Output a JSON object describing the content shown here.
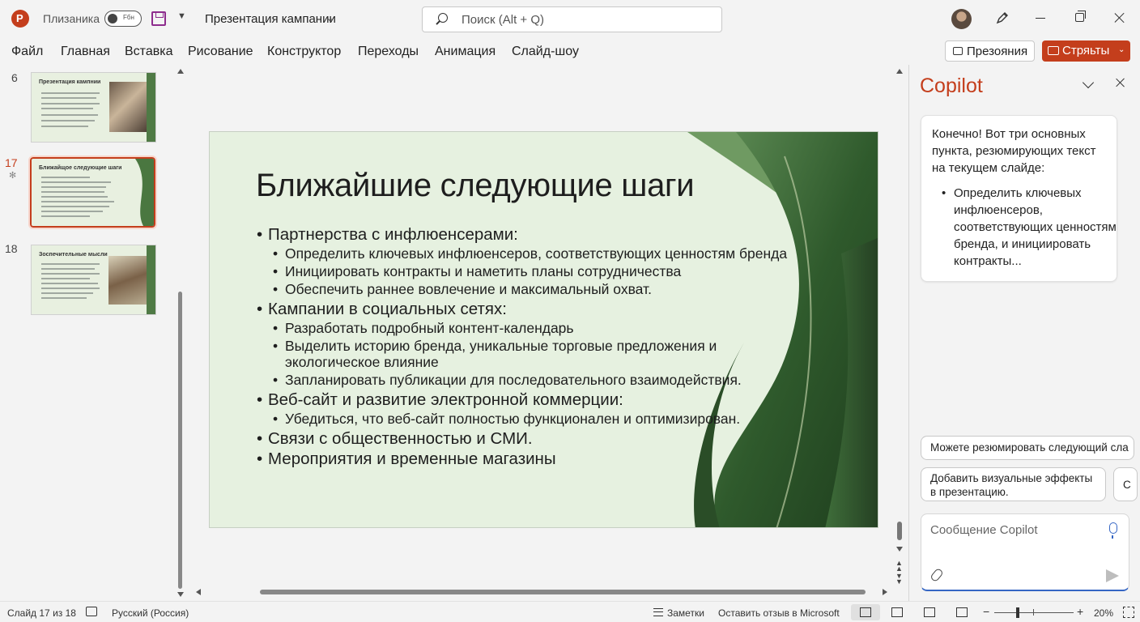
{
  "titlebar": {
    "autosave_label": "Плизаника",
    "autosave_toggle_text": "Fбн",
    "document_title": "Презентация кампании",
    "search_placeholder": "Поиск (Alt + Q)"
  },
  "ribbon": {
    "tabs": [
      "Файл",
      "Главная",
      "Вставка",
      "Рисование",
      "Конструктор",
      "Переходы",
      "Анимация",
      "Слайд-шоу"
    ],
    "present_button": "Презояния",
    "record_button": "Стряьты"
  },
  "thumbnails": [
    {
      "number": "6",
      "title": "Презентация кампнии"
    },
    {
      "number": "17",
      "title": "Ближайщое следующие шаги"
    },
    {
      "number": "18",
      "title": "Зоспечительные мысли"
    }
  ],
  "slide": {
    "title": "Ближайшие следующие шаги",
    "sections": [
      {
        "heading": "Партнерства с инфлюенсерами:",
        "items": [
          "Определить ключевых инфлюенсеров, соответствующих ценностям бренда",
          "Инициировать контракты и наметить планы сотрудничества",
          "Обеспечить раннее вовлечение и максимальный охват."
        ]
      },
      {
        "heading": "Кампании в социальных сетях:",
        "items": [
          "Разработать подробный контент-календарь",
          "Выделить историю бренда, уникальные торговые предложения и экологическое влияние",
          "Запланировать публикации для последовательного взаимодействия."
        ]
      },
      {
        "heading": "Веб-сайт и развитие электронной коммерции:",
        "items": [
          "Убедиться, что веб-сайт полностью функционален и оптимизирован."
        ]
      },
      {
        "heading": "Связи с общественностью и СМИ.",
        "items": []
      },
      {
        "heading": "Мероприятия и временные магазины",
        "items": []
      }
    ]
  },
  "copilot": {
    "title": "Copilot",
    "reply_intro": "Конечно! Вот три основных пункта, резюмирующих текст на текущем слайде:",
    "reply_bullet": "Определить ключевых инфлюенсеров, соответствующих ценностям бренда, и инициировать контракты...",
    "suggestions": [
      "Можете резюмировать следующий сла",
      "Добавить визуальные эффекты в презентацию.",
      "С"
    ],
    "composer_placeholder": "Сообщение Copilot"
  },
  "statusbar": {
    "slide_counter": "Слайд 17 из 18",
    "language": "Русский (Россия)",
    "notes": "Заметки",
    "feedback": "Оставить отзыв в Microsoft",
    "zoom_minus": "−",
    "zoom_plus": "+",
    "zoom_level": "20%"
  },
  "colors": {
    "accent": "#c43e1c",
    "slide_background": "#e6f1e0",
    "link_blue": "#3566c4"
  }
}
